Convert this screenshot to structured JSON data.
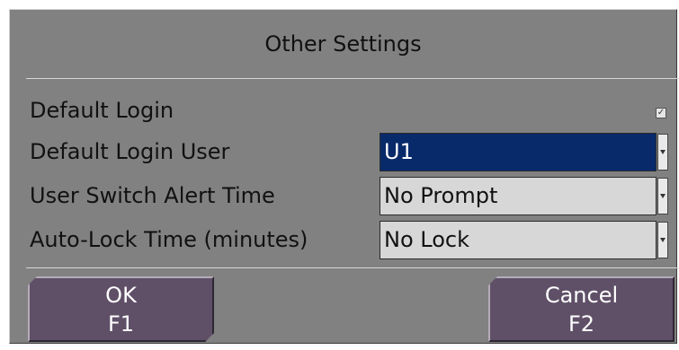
{
  "dialog": {
    "title": "Other Settings"
  },
  "settings": {
    "default_login": {
      "label": "Default Login",
      "checked": true
    },
    "default_login_user": {
      "label": "Default Login User",
      "value": "U1"
    },
    "user_switch_alert_time": {
      "label": "User Switch Alert Time",
      "value": "No Prompt"
    },
    "auto_lock_time": {
      "label": "Auto-Lock Time (minutes)",
      "value": "No Lock"
    }
  },
  "buttons": {
    "ok": {
      "label": "OK",
      "key": "F1"
    },
    "cancel": {
      "label": "Cancel",
      "key": "F2"
    }
  },
  "icons": {
    "checkbox": "checkmark-icon",
    "dropdown": "chevron-down-icon"
  },
  "colors": {
    "dialog_bg": "#818181",
    "selected_field_bg": "#082a6b",
    "button_bg": "#5f5068"
  }
}
